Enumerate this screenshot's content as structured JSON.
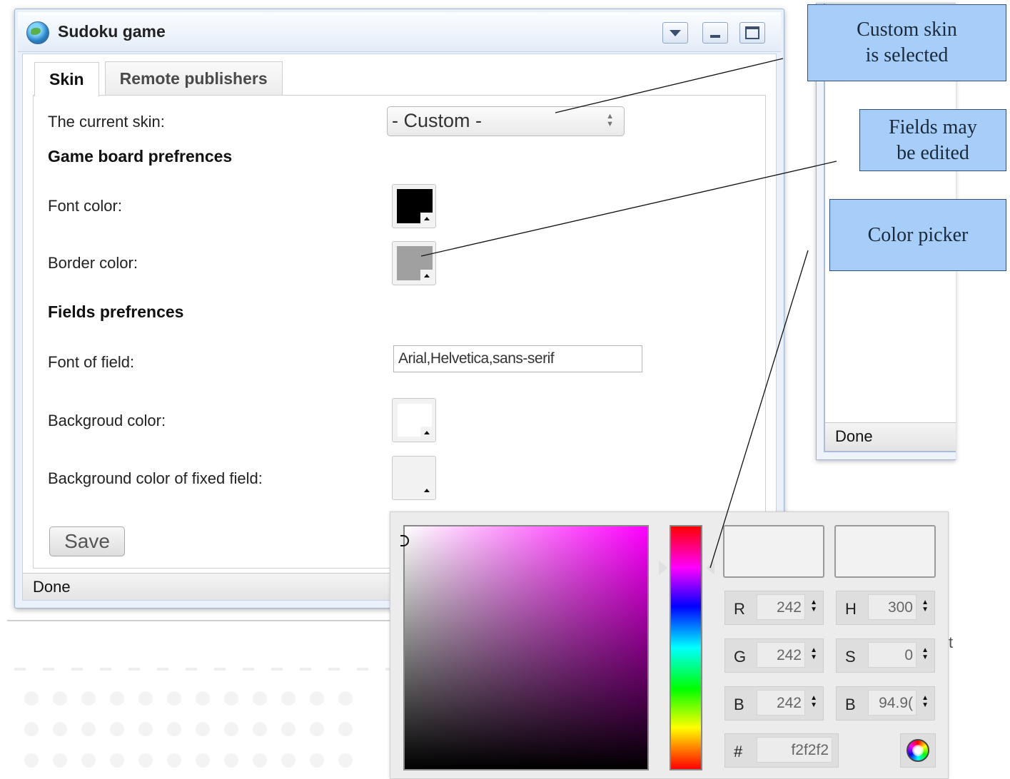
{
  "window": {
    "title": "Sudoku game",
    "tabs": [
      {
        "label": "Skin",
        "active": true
      },
      {
        "label": "Remote publishers",
        "active": false
      }
    ],
    "status": "Done"
  },
  "background_window": {
    "status": "Done"
  },
  "skin_tab": {
    "current_skin_label": "The current skin:",
    "current_skin_value": "- Custom -",
    "game_board_heading": "Game board prefrences",
    "font_color_label": "Font color:",
    "font_color_value": "#000000",
    "border_color_label": "Border color:",
    "border_color_value": "#a0a0a0",
    "fields_heading": "Fields prefrences",
    "font_of_field_label": "Font of field:",
    "font_of_field_value": "Arial,Helvetica,sans-serif",
    "background_color_label": "Backgroud color:",
    "background_color_value": "#ffffff",
    "fixed_bg_label": "Background color of fixed field:",
    "fixed_bg_value": "#f2f2f2",
    "save_label": "Save"
  },
  "color_picker": {
    "current_hue_color": "#ff00ff",
    "preview_new": "#f2f2f2",
    "preview_old": "#f2f2f2",
    "rgb": [
      {
        "letter": "R",
        "value": "242"
      },
      {
        "letter": "G",
        "value": "242"
      },
      {
        "letter": "B",
        "value": "242"
      }
    ],
    "hsb": [
      {
        "letter": "H",
        "value": "300"
      },
      {
        "letter": "S",
        "value": "0"
      },
      {
        "letter": "B",
        "value": "94.9("
      }
    ],
    "hex_symbol": "#",
    "hex_value": "f2f2f2"
  },
  "callouts": {
    "custom_skin": "Custom skin\nis selected",
    "fields_edited": "Fields may\nbe edited",
    "color_picker": "Color picker"
  },
  "edge_text": "t"
}
